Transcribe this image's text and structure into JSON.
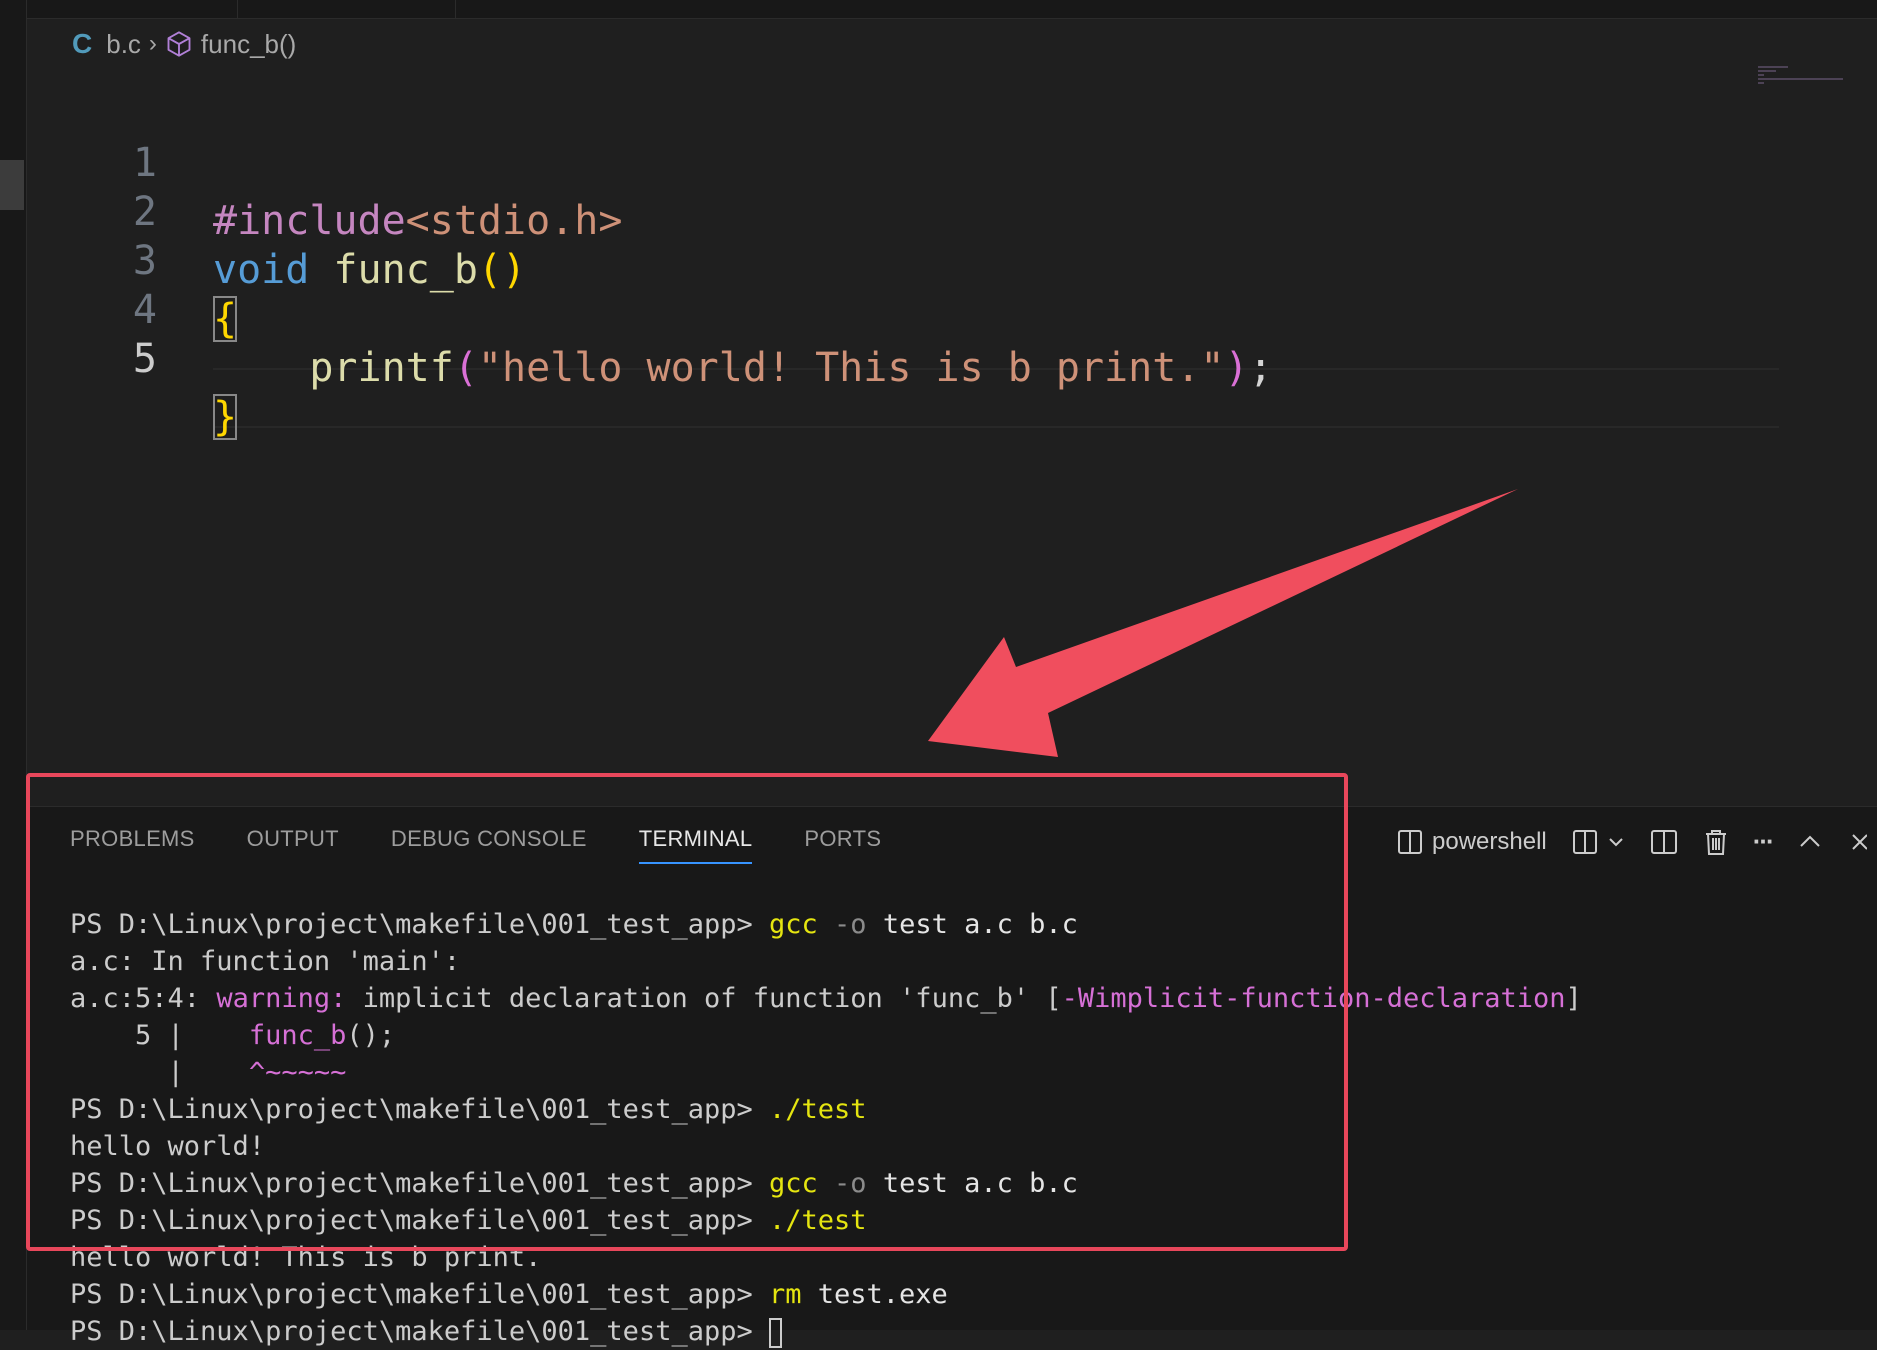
{
  "breadcrumb": {
    "file": "b.c",
    "symbol": "func_b()"
  },
  "editor": {
    "lines": [
      {
        "n": "1",
        "include": "#include",
        "header": "<stdio.h>"
      },
      {
        "n": "2",
        "type": "void",
        "name": "func_b",
        "parens": "()"
      },
      {
        "n": "3",
        "text": "{"
      },
      {
        "n": "4",
        "call": "printf",
        "open": "(",
        "arg": "\"hello world! This is b print.\"",
        "close": ")",
        "end": ";"
      },
      {
        "n": "5",
        "text": "}"
      }
    ]
  },
  "panel": {
    "tabs": [
      "PROBLEMS",
      "OUTPUT",
      "DEBUG CONSOLE",
      "TERMINAL",
      "PORTS"
    ],
    "active_tab": "TERMINAL",
    "shell_name": "powershell",
    "more_glyph": "···"
  },
  "terminal": {
    "prompt": "PS D:\\Linux\\project\\makefile\\001_test_app> ",
    "cmd_gcc": "gcc",
    "flag_o": "-o",
    "gcc_args": "test a.c b.c",
    "run_cmd": "./test",
    "warn_file_line": "a.c: In function 'main':",
    "warn_loc": "a.c:5:4:",
    "warn_label": "warning:",
    "warn_text": "implicit declaration of function 'func_b' [",
    "warn_flag": "-Wimplicit-function-declaration",
    "warn_close": "]",
    "src_lineno": "    5 |    ",
    "src_call": "func_b",
    "src_rest": "();",
    "caret_bar": "      |    ",
    "caret": "^~~~~~",
    "out1": "hello world!",
    "out2": "hello world! This is b print.",
    "rm_cmd": "rm",
    "rm_arg": "test.exe"
  },
  "colors": {
    "highlight_box": "#e8475b",
    "active_tab_underline": "#3794ff"
  }
}
